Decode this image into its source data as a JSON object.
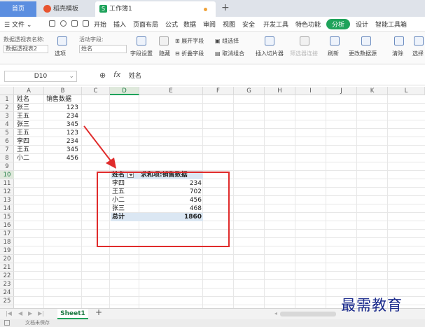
{
  "tabs": {
    "home": "首页",
    "template": "稻壳模板",
    "workbook": "工作簿1",
    "workbook_icon": "S",
    "new_tab": "+"
  },
  "menu": {
    "file": "文件",
    "items": [
      "开始",
      "插入",
      "页面布局",
      "公式",
      "数据",
      "审阅",
      "视图",
      "安全",
      "开发工具",
      "特色功能",
      "分析",
      "设计",
      "智能工具箱"
    ],
    "active": "分析"
  },
  "ribbon": {
    "pivot_name_label": "数据透视表名称:",
    "pivot_name_value": "数据透视表2",
    "options": "选项",
    "active_field_label": "活动字段:",
    "active_field_value": "姓名",
    "field_settings": "字段设置",
    "drill": "隐藏",
    "expand_field": "展开字段",
    "collapse_field": "折叠字段",
    "group_selection": "组选择",
    "ungroup": "取消组合",
    "insert_slicer": "插入切片器",
    "filter_connections": "筛选器连接",
    "refresh": "刷新",
    "change_source": "更改数据源",
    "clear": "清除",
    "select": "选择"
  },
  "formula_bar": {
    "cell_ref": "D10",
    "fx": "fx",
    "content": "姓名"
  },
  "columns": [
    "A",
    "B",
    "C",
    "D",
    "E",
    "F",
    "G",
    "H",
    "I",
    "J",
    "K",
    "L"
  ],
  "active_column": "D",
  "rows": [
    "1",
    "2",
    "3",
    "4",
    "5",
    "6",
    "7",
    "8",
    "9",
    "10",
    "11",
    "12",
    "13",
    "14",
    "15",
    "16",
    "17",
    "18",
    "19",
    "20",
    "21",
    "22",
    "23",
    "24",
    "25"
  ],
  "active_row": "10",
  "source_table": {
    "header_name": "姓名",
    "header_sales": "销售数据",
    "rows": [
      {
        "name": "张三",
        "sales": "123"
      },
      {
        "name": "王五",
        "sales": "234"
      },
      {
        "name": "张三",
        "sales": "345"
      },
      {
        "name": "王五",
        "sales": "123"
      },
      {
        "name": "李四",
        "sales": "234"
      },
      {
        "name": "王五",
        "sales": "345"
      },
      {
        "name": "小二",
        "sales": "456"
      }
    ]
  },
  "pivot": {
    "header_row_label": "姓名",
    "header_value": "求和项:销售数据",
    "rows": [
      {
        "name": "李四",
        "value": "234"
      },
      {
        "name": "王五",
        "value": "702"
      },
      {
        "name": "小二",
        "value": "456"
      },
      {
        "name": "张三",
        "value": "468"
      }
    ],
    "total_label": "总计",
    "total_value": "1860"
  },
  "sheet_tabs": {
    "sheet1": "Sheet1",
    "add": "+"
  },
  "status": {
    "text": "文档未保存"
  },
  "watermark": "最需教育",
  "colors": {
    "accent_green": "#1fa35b",
    "annotation_red": "#e02b2b",
    "pivot_header": "#dbe7f3"
  }
}
